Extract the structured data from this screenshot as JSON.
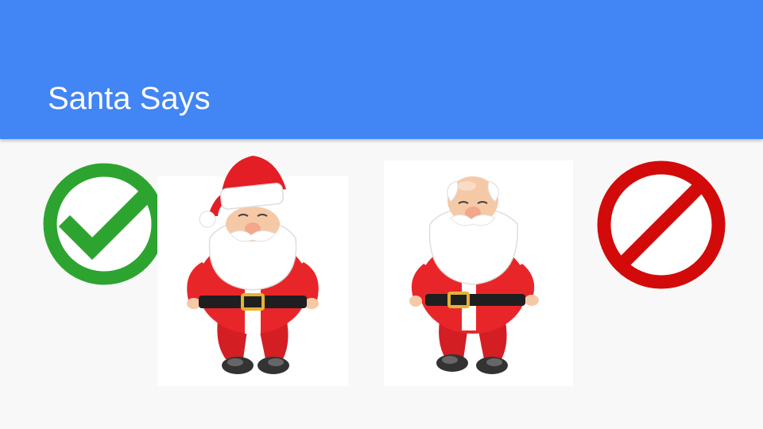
{
  "slide": {
    "title": "Santa Says",
    "header_color": "#4285f4",
    "background_color": "#f8f8f8"
  },
  "left_image": {
    "subject": "santa-with-hat",
    "icon": "check-icon"
  },
  "right_image": {
    "subject": "santa-without-hat",
    "icon": "prohibited-icon"
  },
  "colors": {
    "check_green": "#2da42f",
    "prohibit_red": "#d20a0a",
    "suit_red": "#e8262a",
    "beard_white": "#ffffff",
    "skin": "#f6c9a6",
    "belt_black": "#1f1f1f",
    "buckle_gold": "#e4b335"
  }
}
